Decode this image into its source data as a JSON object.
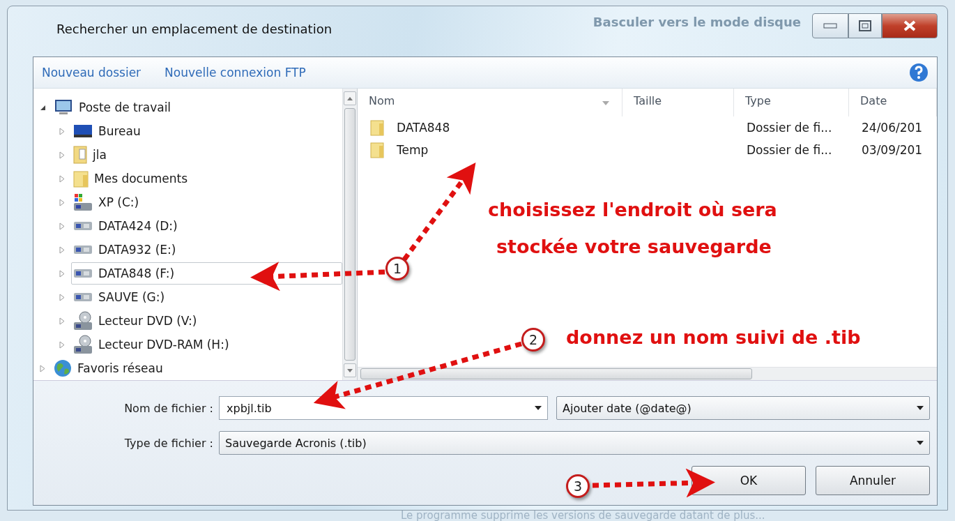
{
  "background_window": {
    "caption": "Basculer vers le mode disque",
    "status": "Le programme supprime les versions de sauvegarde datant de plus..."
  },
  "window": {
    "title": "Rechercher un emplacement de destination"
  },
  "toolbar": {
    "links": [
      "Nouveau dossier",
      "Nouvelle connexion FTP"
    ]
  },
  "tree": [
    {
      "label": "Poste de travail",
      "kind": "computer",
      "expanded": true,
      "selected": false,
      "children": [
        {
          "label": "Bureau",
          "kind": "desktop",
          "expanded": false,
          "selected": false
        },
        {
          "label": "jla",
          "kind": "userfolder",
          "expanded": false,
          "selected": false
        },
        {
          "label": "Mes documents",
          "kind": "folder",
          "expanded": false,
          "selected": false
        },
        {
          "label": "XP (C:)",
          "kind": "systemdrive",
          "expanded": false,
          "selected": false
        },
        {
          "label": "DATA424 (D:)",
          "kind": "drive",
          "expanded": false,
          "selected": false
        },
        {
          "label": "DATA932 (E:)",
          "kind": "drive",
          "expanded": false,
          "selected": false
        },
        {
          "label": "DATA848 (F:)",
          "kind": "drive",
          "expanded": false,
          "selected": true
        },
        {
          "label": "SAUVE (G:)",
          "kind": "drive",
          "expanded": false,
          "selected": false
        },
        {
          "label": "Lecteur DVD (V:)",
          "kind": "dvd",
          "expanded": false,
          "selected": false
        },
        {
          "label": "Lecteur DVD-RAM (H:)",
          "kind": "dvd",
          "expanded": false,
          "selected": false
        }
      ]
    },
    {
      "label": "Favoris réseau",
      "kind": "network",
      "expanded": false,
      "selected": false
    }
  ],
  "list": {
    "columns": [
      "Nom",
      "Taille",
      "Type",
      "Date"
    ],
    "rows": [
      {
        "name": "DATA848",
        "type": "Dossier de fi...",
        "date": "24/06/201"
      },
      {
        "name": "Temp",
        "type": "Dossier de fi...",
        "date": "03/09/201"
      }
    ]
  },
  "form": {
    "filename_label": "Nom de fichier :",
    "filename": "xpbjl.tib",
    "date_option": "Ajouter date (@date@)",
    "filetype_label": "Type de fichier :",
    "filetype": "Sauvegarde Acronis (.tib)"
  },
  "buttons": [
    "OK",
    "Annuler"
  ],
  "annotations": {
    "steps": [
      "1",
      "2",
      "3"
    ],
    "notes": [
      "choisissez l'endroit où sera",
      "stockée votre sauvegarde",
      "donnez un nom suivi de .tib"
    ]
  }
}
